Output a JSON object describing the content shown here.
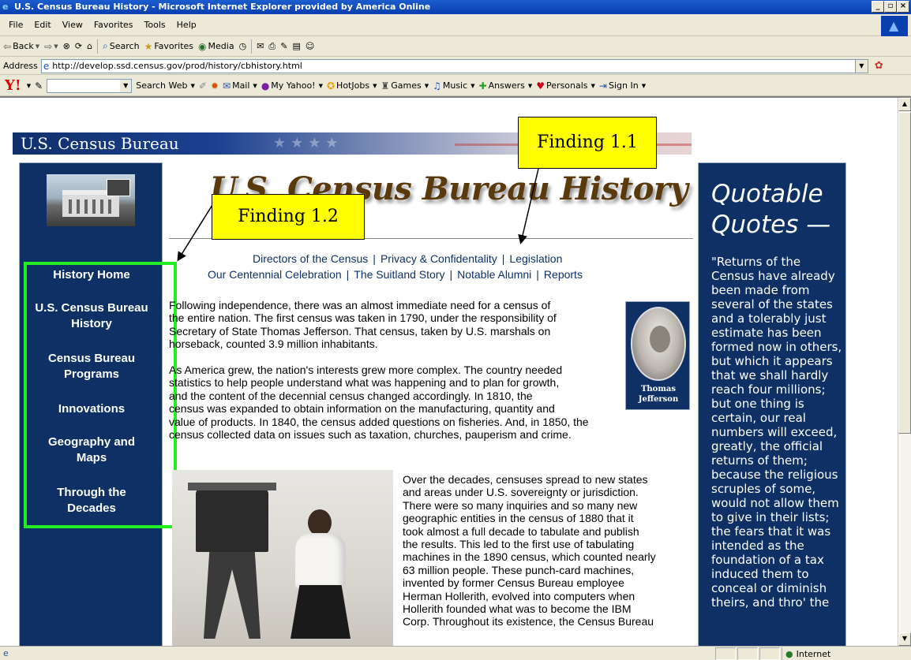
{
  "window": {
    "title": "U.S. Census Bureau History - Microsoft Internet Explorer provided by America Online",
    "controls": [
      "_",
      "×"
    ]
  },
  "menu": [
    "File",
    "Edit",
    "View",
    "Favorites",
    "Tools",
    "Help"
  ],
  "toolbar": {
    "back": "Back",
    "search": "Search",
    "favorites": "Favorites",
    "media": "Media"
  },
  "address": {
    "label": "Address",
    "url": "http://develop.ssd.census.gov/prod/history/cbhistory.html"
  },
  "yahoo_toolbar": {
    "logo": "Y!",
    "search_web": "Search Web",
    "items": [
      "Mail",
      "My Yahoo!",
      "HotJobs",
      "Games",
      "Music",
      "Answers",
      "Personals",
      "Sign In"
    ]
  },
  "page": {
    "banner_title": "U.S. Census Bureau",
    "main_title": "U.S. Census Bureau History",
    "left_nav": [
      "History Home",
      "U.S. Census Bureau History",
      "Census Bureau Programs",
      "Innovations",
      "Geography and Maps",
      "Through the Decades"
    ],
    "links_row1": [
      "Directors of the Census",
      "Privacy & Confidentality",
      "Legislation"
    ],
    "links_row2": [
      "Our Centennial Celebration",
      "The Suitland Story",
      "Notable Alumni",
      "Reports"
    ],
    "para1_lines": [
      "Following independence, there was an almost immediate need for a census of",
      "the entire nation. The first census was taken in 1790, under the responsibility of",
      "Secretary of State Thomas Jefferson. That census, taken by U.S. marshals on",
      "horseback, counted 3.9 million inhabitants."
    ],
    "para2_lines": [
      "As America grew, the nation's interests grew more complex. The country needed",
      "statistics to help people understand what was happening and to plan for growth,",
      "and the content of the decennial census changed accordingly. In 1810, the",
      "census was expanded to obtain information on the manufacturing, quantity and",
      "value of products. In 1840, the census added questions on fisheries. And, in 1850, the",
      "census collected data on issues such as taxation, churches, pauperism and crime."
    ],
    "para3_lines": [
      "Over the decades, censuses spread to new states",
      "and areas under U.S. sovereignty or jurisdiction.",
      "There were so many inquiries and so many new",
      "geographic entities in the census of 1880 that it",
      "took almost a full decade to tabulate and publish",
      "the results. This led to the first use of tabulating",
      "machines in the 1890 census, which counted nearly",
      "63 million people. These punch-card machines,",
      "invented by former Census Bureau employee",
      "Herman Hollerith, evolved into computers when",
      "Hollerith founded what was to become the IBM",
      "Corp. Throughout its existence, the Census Bureau"
    ],
    "jefferson_caption": [
      "Thomas",
      "Jefferson"
    ],
    "quote_heading_lines": [
      "Quotable",
      "Quotes —"
    ],
    "quote_lines": [
      "\"Returns of the",
      "Census have already",
      "been made from",
      "several of the states",
      "and a tolerably just",
      "estimate has been",
      "formed now in others,",
      "but which it appears",
      "that we shall hardly",
      "reach four millions;",
      "but one thing is",
      "certain, our real",
      "numbers will exceed,",
      "greatly, the official",
      "returns of them;",
      "because the religious",
      "scruples of some,",
      "would not allow them",
      "to give in their lists;",
      "the fears that it was",
      "intended as the",
      "foundation of a tax",
      "induced them to",
      "conceal or diminish",
      "theirs, and thro' the"
    ]
  },
  "callouts": {
    "finding_1_1": "Finding 1.1",
    "finding_1_2": "Finding 1.2"
  },
  "status": {
    "zone": "Internet"
  },
  "colors": {
    "panel_navy": "#0e3064",
    "highlight_green": "#22ee22",
    "callout_yellow": "#ffff00",
    "title_brown": "#5a3a0d"
  }
}
